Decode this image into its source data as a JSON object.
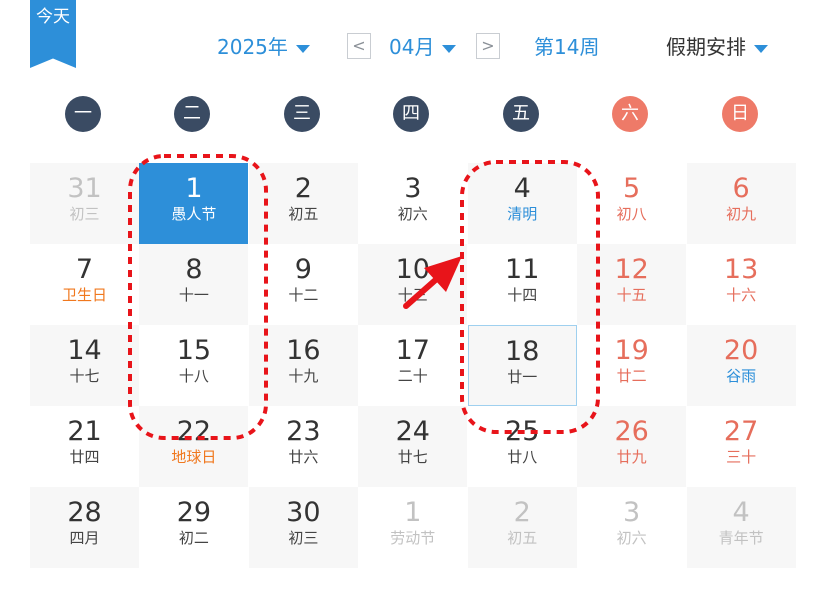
{
  "today_badge": "今天",
  "header": {
    "year_label": "2025年",
    "prev_arrow": "<",
    "month_label": "04月",
    "next_arrow": ">",
    "week_label": "第14周",
    "holiday_label": "假期安排"
  },
  "weekdays": [
    "一",
    "二",
    "三",
    "四",
    "五",
    "六",
    "日"
  ],
  "colors": {
    "accent": "#2d8fd9",
    "weekend": "#e66e5c",
    "weekday_circle": "#3a4b63",
    "annotation": "#e8141a"
  },
  "weeks": [
    [
      {
        "num": "31",
        "sub": "初三",
        "other": true
      },
      {
        "num": "1",
        "sub": "愚人节",
        "today": true
      },
      {
        "num": "2",
        "sub": "初五"
      },
      {
        "num": "3",
        "sub": "初六"
      },
      {
        "num": "4",
        "sub": "清明",
        "festival": "blue"
      },
      {
        "num": "5",
        "sub": "初八"
      },
      {
        "num": "6",
        "sub": "初九"
      }
    ],
    [
      {
        "num": "7",
        "sub": "卫生日",
        "festival": "orange"
      },
      {
        "num": "8",
        "sub": "十一"
      },
      {
        "num": "9",
        "sub": "十二"
      },
      {
        "num": "10",
        "sub": "十三"
      },
      {
        "num": "11",
        "sub": "十四"
      },
      {
        "num": "12",
        "sub": "十五"
      },
      {
        "num": "13",
        "sub": "十六"
      }
    ],
    [
      {
        "num": "14",
        "sub": "十七"
      },
      {
        "num": "15",
        "sub": "十八"
      },
      {
        "num": "16",
        "sub": "十九"
      },
      {
        "num": "17",
        "sub": "二十"
      },
      {
        "num": "18",
        "sub": "廿一",
        "selected": true
      },
      {
        "num": "19",
        "sub": "廿二"
      },
      {
        "num": "20",
        "sub": "谷雨",
        "festival": "blue"
      }
    ],
    [
      {
        "num": "21",
        "sub": "廿四"
      },
      {
        "num": "22",
        "sub": "地球日",
        "festival": "orange"
      },
      {
        "num": "23",
        "sub": "廿六"
      },
      {
        "num": "24",
        "sub": "廿七"
      },
      {
        "num": "25",
        "sub": "廿八"
      },
      {
        "num": "26",
        "sub": "廿九"
      },
      {
        "num": "27",
        "sub": "三十"
      }
    ],
    [
      {
        "num": "28",
        "sub": "四月"
      },
      {
        "num": "29",
        "sub": "初二"
      },
      {
        "num": "30",
        "sub": "初三"
      },
      {
        "num": "1",
        "sub": "劳动节",
        "other": true
      },
      {
        "num": "2",
        "sub": "初五",
        "other": true
      },
      {
        "num": "3",
        "sub": "初六",
        "other": true
      },
      {
        "num": "4",
        "sub": "青年节",
        "other": true
      }
    ]
  ]
}
